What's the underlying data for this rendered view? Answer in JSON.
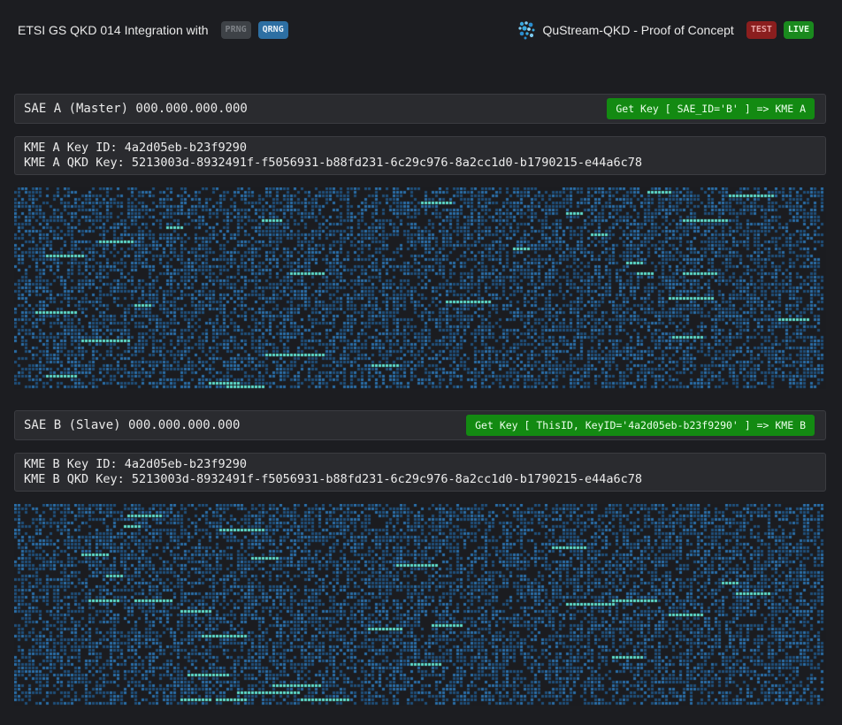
{
  "header": {
    "title": "ETSI GS QKD 014 Integration with",
    "rng_options": [
      "PRNG",
      "QRNG"
    ],
    "selected_rng": "QRNG",
    "brand": "QuStream-QKD - Proof of Concept",
    "env_options": [
      "TEST",
      "LIVE"
    ],
    "selected_env": "LIVE",
    "brand_icon": "dots-cluster-icon"
  },
  "sae_a": {
    "title": "SAE A (Master) 000.000.000.000",
    "button_label": "Get Key [ SAE_ID='B' ] => KME A",
    "key_id_line": "KME A Key ID: 4a2d05eb-b23f9290",
    "qkd_key_line": "KME A QKD Key: 5213003d-8932491f-f5056931-b88fd231-6c29c976-8a2cc1d0-b1790215-e44a6c78"
  },
  "sae_b": {
    "title": "SAE B (Slave) 000.000.000.000",
    "button_label": "Get Key [ ThisID, KeyID='4a2d05eb-b23f9290' ] => KME B",
    "key_id_line": "KME B Key ID: 4a2d05eb-b23f9290",
    "qkd_key_line": "KME B QKD Key: 5213003d-8932491f-f5056931-b88fd231-6c29c976-8a2cc1d0-b1790215-e44a6c78"
  },
  "colors": {
    "background": "#1c1d21",
    "panel": "#2a2b2f",
    "matrix_dot": "#2a6ea8",
    "matrix_dot_dim": "#1f4f7a",
    "matrix_highlight": "#5fe0d0",
    "button_green": "#138a12",
    "prng": "#3e4247",
    "qrng": "#2d6fa3",
    "test": "#8b1e1e",
    "live": "#1a8a1e"
  }
}
